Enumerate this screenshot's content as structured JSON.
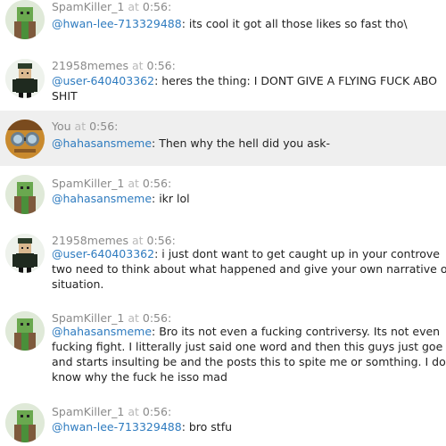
{
  "messages": [
    {
      "author": "SpamKiller_1",
      "at": "at",
      "time": "0:56:",
      "avatar": "green-blocky-avatar",
      "mention": "@hwan-lee-713329488",
      "lines": [
        "its cool it got all those likes so fast tho\\"
      ]
    },
    {
      "author": "21958memes",
      "at": "at",
      "time": "0:56:",
      "avatar": "dark-soldier-avatar",
      "mention": "@user-640403362",
      "lines": [
        "heres the thing: I DONT GIVE A FLYING FUCK ABO",
        "SHIT"
      ]
    },
    {
      "author": "You",
      "at": "at",
      "time": "0:56:",
      "avatar": "goggles-avatar",
      "self": true,
      "mention": "@hahasansmeme",
      "lines": [
        "Then why the hell did you ask-"
      ]
    },
    {
      "author": "SpamKiller_1",
      "at": "at",
      "time": "0:56:",
      "avatar": "green-blocky-avatar",
      "mention": "@hahasansmeme",
      "lines": [
        "ikr lol"
      ]
    },
    {
      "author": "21958memes",
      "at": "at",
      "time": "0:56:",
      "avatar": "dark-soldier-avatar",
      "mention": "@user-640403362",
      "lines": [
        "i just dont want to get caught up in your controve",
        "two need to think about what happened and give your own narrative o",
        "situation."
      ]
    },
    {
      "author": "SpamKiller_1",
      "at": "at",
      "time": "0:56:",
      "avatar": "green-blocky-avatar",
      "mention": "@hahasansmeme",
      "lines": [
        "Bro its not even a fucking contriversy. Its not even",
        "fucking fight. I litterally just said one word and then this guys just goe",
        "and starts insulting be and the posts this to spite me or somthing. I do",
        "know why the fuck he isso mad"
      ]
    },
    {
      "author": "SpamKiller_1",
      "at": "at",
      "time": "0:56:",
      "avatar": "green-blocky-avatar",
      "mention": "@hwan-lee-713329488",
      "lines": [
        "bro stfu"
      ]
    }
  ]
}
